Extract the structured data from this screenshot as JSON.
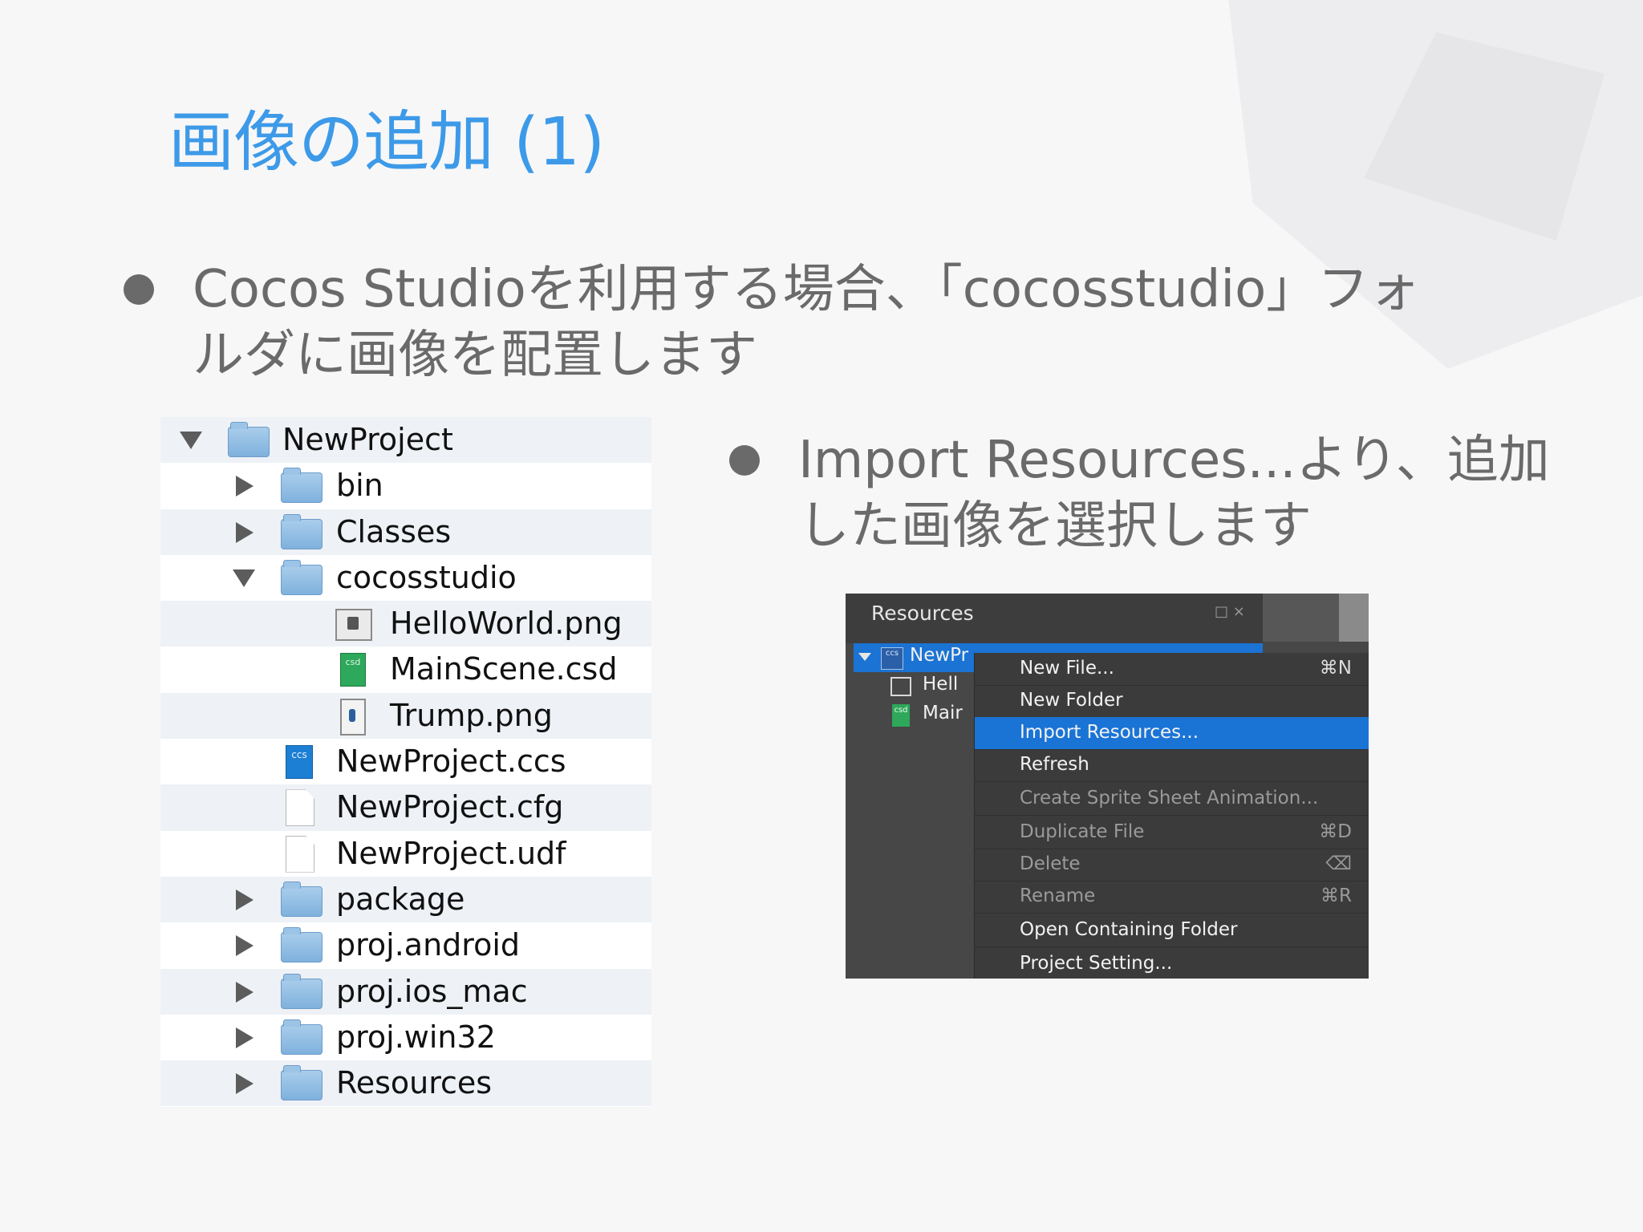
{
  "slide": {
    "title": "画像の追加 (1)",
    "bullet1": [
      "Cocos Studioを利用する場合、「cocosstudio」フォ",
      "ルダに画像を配置します"
    ],
    "bullet2": [
      "Import Resources...より、追加",
      "した画像を選択します"
    ]
  },
  "finder": {
    "rows": [
      {
        "label": "NewProject",
        "icon": "folder-icon",
        "disclosure": "down"
      },
      {
        "label": "bin",
        "icon": "folder-icon",
        "disclosure": "right"
      },
      {
        "label": "Classes",
        "icon": "folder-icon",
        "disclosure": "right"
      },
      {
        "label": "cocosstudio",
        "icon": "folder-icon",
        "disclosure": "down"
      },
      {
        "label": "HelloWorld.png",
        "icon": "png-file-icon",
        "disclosure": "none"
      },
      {
        "label": "MainScene.csd",
        "icon": "csd-file-icon",
        "disclosure": "none"
      },
      {
        "label": "Trump.png",
        "icon": "png-file-icon",
        "disclosure": "none"
      },
      {
        "label": "NewProject.ccs",
        "icon": "ccs-file-icon",
        "disclosure": "none"
      },
      {
        "label": "NewProject.cfg",
        "icon": "document-icon",
        "disclosure": "none"
      },
      {
        "label": "NewProject.udf",
        "icon": "document-icon",
        "disclosure": "none"
      },
      {
        "label": "package",
        "icon": "folder-icon",
        "disclosure": "right"
      },
      {
        "label": "proj.android",
        "icon": "folder-icon",
        "disclosure": "right"
      },
      {
        "label": "proj.ios_mac",
        "icon": "folder-icon",
        "disclosure": "right"
      },
      {
        "label": "proj.win32",
        "icon": "folder-icon",
        "disclosure": "right"
      },
      {
        "label": "Resources",
        "icon": "folder-icon",
        "disclosure": "right"
      }
    ],
    "csd_badge": "csd",
    "ccs_badge": "ccs"
  },
  "resources_panel": {
    "title": "Resources",
    "controls": "□ ×",
    "tree": {
      "project": "NewPr",
      "hello": "Hell",
      "main": "Mair",
      "ccs_badge": "ccs",
      "csd_badge": "csd"
    },
    "menu": [
      {
        "label": "New File...",
        "shortcut": "⌘N",
        "state": "enabled"
      },
      {
        "label": "New Folder",
        "shortcut": "",
        "state": "enabled"
      },
      {
        "label": "Import Resources...",
        "shortcut": "",
        "state": "selected"
      },
      {
        "label": "Refresh",
        "shortcut": "",
        "state": "enabled"
      },
      {
        "label": "Create Sprite Sheet Animation...",
        "shortcut": "",
        "state": "disabled"
      },
      {
        "label": "Duplicate File",
        "shortcut": "⌘D",
        "state": "disabled"
      },
      {
        "label": "Delete",
        "shortcut": "⌫",
        "state": "disabled"
      },
      {
        "label": "Rename",
        "shortcut": "⌘R",
        "state": "disabled"
      },
      {
        "label": "Open Containing Folder",
        "shortcut": "",
        "state": "enabled"
      },
      {
        "label": "Project Setting...",
        "shortcut": "",
        "state": "enabled"
      }
    ]
  },
  "colors": {
    "title": "#3d9ae8",
    "body_text": "#6a6a6a",
    "selection": "#1a74d6"
  }
}
